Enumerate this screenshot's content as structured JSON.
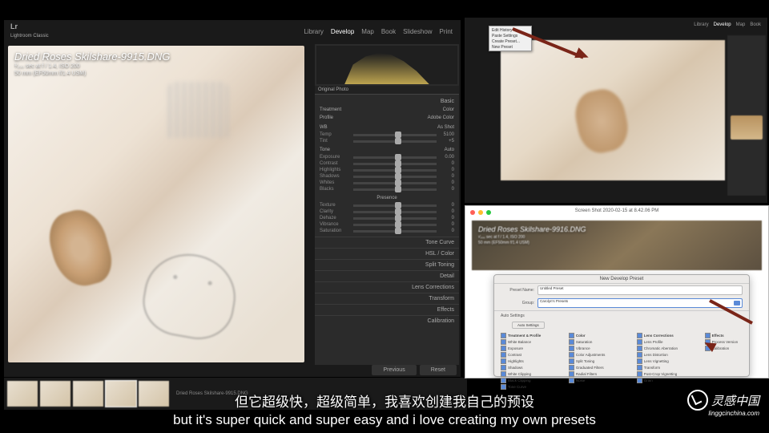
{
  "main": {
    "logo_line1": "Lr",
    "logo_line2": "Lightroom Classic",
    "modules": [
      "Library",
      "Develop",
      "Map",
      "Book",
      "Slideshow",
      "Print"
    ],
    "active_module": "Develop",
    "image": {
      "title": "Dried Roses Skilshare-9915.DNG",
      "sub1": "¹⁄₂₀₀ sec at f / 1.4, ISO 200",
      "sub2": "50 mm (EF50mm f/1.4 USM)"
    },
    "histo_label_l": "Original Photo",
    "panel": {
      "basic": "Basic",
      "treatment_l": "Treatment",
      "treatment_r": "Color",
      "profile_l": "Profile",
      "profile_r": "Adobe Color",
      "wb_l": "WB",
      "wb_r": "As Shot",
      "temp": "Temp",
      "temp_v": "5100",
      "tint": "Tint",
      "tint_v": "+5",
      "tone": "Tone",
      "tone_btn": "Auto",
      "exposure": "Exposure",
      "exposure_v": "0.00",
      "contrast": "Contrast",
      "contrast_v": "0",
      "highlights": "Highlights",
      "highlights_v": "0",
      "shadows": "Shadows",
      "shadows_v": "0",
      "whites": "Whites",
      "whites_v": "0",
      "blacks": "Blacks",
      "blacks_v": "0",
      "presence": "Presence",
      "texture": "Texture",
      "texture_v": "0",
      "clarity": "Clarity",
      "clarity_v": "0",
      "dehaze": "Dehaze",
      "dehaze_v": "0",
      "vibrance": "Vibrance",
      "vibrance_v": "0",
      "saturation": "Saturation",
      "saturation_v": "0",
      "collapsed": [
        "Tone Curve",
        "HSL / Color",
        "Split Toning",
        "Detail",
        "Lens Corrections",
        "Transform",
        "Effects",
        "Calibration"
      ]
    },
    "btn_prev": "Previous",
    "btn_reset": "Reset",
    "filmstrip_label": "Dried Roses Skilshare-9915.DNG"
  },
  "menu": {
    "items": [
      "Edit History",
      "Paste Settings",
      "Create Preset...",
      "New Preset"
    ]
  },
  "dlg": {
    "wintitle": "Screen Shot 2020-02-15 at 8.42.06 PM",
    "photo": {
      "title": "Dried Roses Skilshare-9916.DNG",
      "sub1": "¹⁄₂₀₀ sec at f / 1.4, ISO 200",
      "sub2": "50 mm (EF50mm f/1.4 USM)"
    },
    "preset": {
      "title": "New Develop Preset",
      "name_l": "Preset Name:",
      "name_v": "Untitled Preset",
      "group_l": "Group:",
      "group_v": "Carolyn's Presets",
      "settings_l": "Auto Settings",
      "settings_btn": "Auto Settings",
      "col1_h": "Treatment & Profile",
      "col1": [
        "White Balance",
        "Exposure",
        "Contrast",
        "Highlights",
        "Shadows",
        "White Clipping",
        "Black Clipping",
        "Tone Curve"
      ],
      "col2_h": "Color",
      "col2": [
        "Saturation",
        "Vibrance",
        "Color Adjustments",
        "Split Toning",
        "Graduated Filters",
        "Radial Filters",
        "Noise"
      ],
      "col3_h": "Lens Corrections",
      "col3": [
        "Lens Profile",
        "Chromatic Aberration",
        "Lens Distortion",
        "Lens Vignetting",
        "Transform",
        "Post-Crop Vignetting",
        "Grain"
      ],
      "col4_h": "Effects",
      "col4": [
        "Process Version",
        "Calibration"
      ]
    }
  },
  "subs": {
    "cn": "但它超级快，超级简单，我喜欢创建我自己的预设",
    "en": "but it's super quick and super easy and i love creating my own presets"
  },
  "watermark": {
    "text": "灵感中国",
    "url": "linggcinchina.com"
  }
}
